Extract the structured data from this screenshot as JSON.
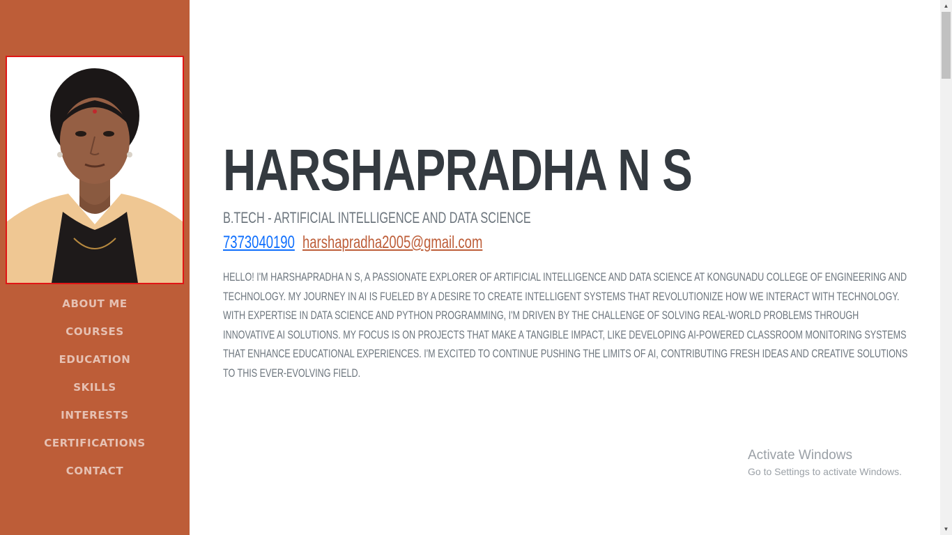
{
  "sidebar": {
    "nav": [
      {
        "label": "About Me"
      },
      {
        "label": "Courses"
      },
      {
        "label": "Education"
      },
      {
        "label": "Skills"
      },
      {
        "label": "Interests"
      },
      {
        "label": "Certifications"
      },
      {
        "label": "Contact"
      }
    ]
  },
  "profile": {
    "name": "HARSHAPRADHA N S",
    "subheading": "B.TECH - ARTIFICIAL INTELLIGENCE AND DATA SCIENCE",
    "phone": "7373040190",
    "email": "harshapradha2005@gmail.com",
    "about": "HELLO! I'M HARSHAPRADHA N S, A PASSIONATE EXPLORER OF ARTIFICIAL INTELLIGENCE AND DATA SCIENCE AT KONGUNADU COLLEGE OF ENGINEERING AND TECHNOLOGY. MY JOURNEY IN AI IS FUELED BY A DESIRE TO CREATE INTELLIGENT SYSTEMS THAT REVOLUTIONIZE HOW WE INTERACT WITH TECHNOLOGY. WITH EXPERTISE IN DATA SCIENCE AND PYTHON PROGRAMMING, I'M DRIVEN BY THE CHALLENGE OF SOLVING REAL-WORLD PROBLEMS THROUGH INNOVATIVE AI SOLUTIONS. MY FOCUS IS ON PROJECTS THAT MAKE A TANGIBLE IMPACT, LIKE DEVELOPING AI-POWERED CLASSROOM MONITORING SYSTEMS THAT ENHANCE EDUCATIONAL EXPERIENCES. I'M EXCITED TO CONTINUE PUSHING THE LIMITS OF AI, CONTRIBUTING FRESH IDEAS AND CREATIVE SOLUTIONS TO THIS EVER-EVOLVING FIELD."
  },
  "watermark": {
    "title": "Activate Windows",
    "subtitle": "Go to Settings to activate Windows."
  },
  "colors": {
    "sidebar_bg": "#bd5d38",
    "photo_border": "#e01515",
    "heading": "#343a40",
    "muted_text": "#6c757d",
    "phone_link": "#0d6efd",
    "email_link": "#bd5d38"
  },
  "icons": [
    "profile-photo",
    "scroll-up-arrow",
    "scroll-down-arrow"
  ]
}
